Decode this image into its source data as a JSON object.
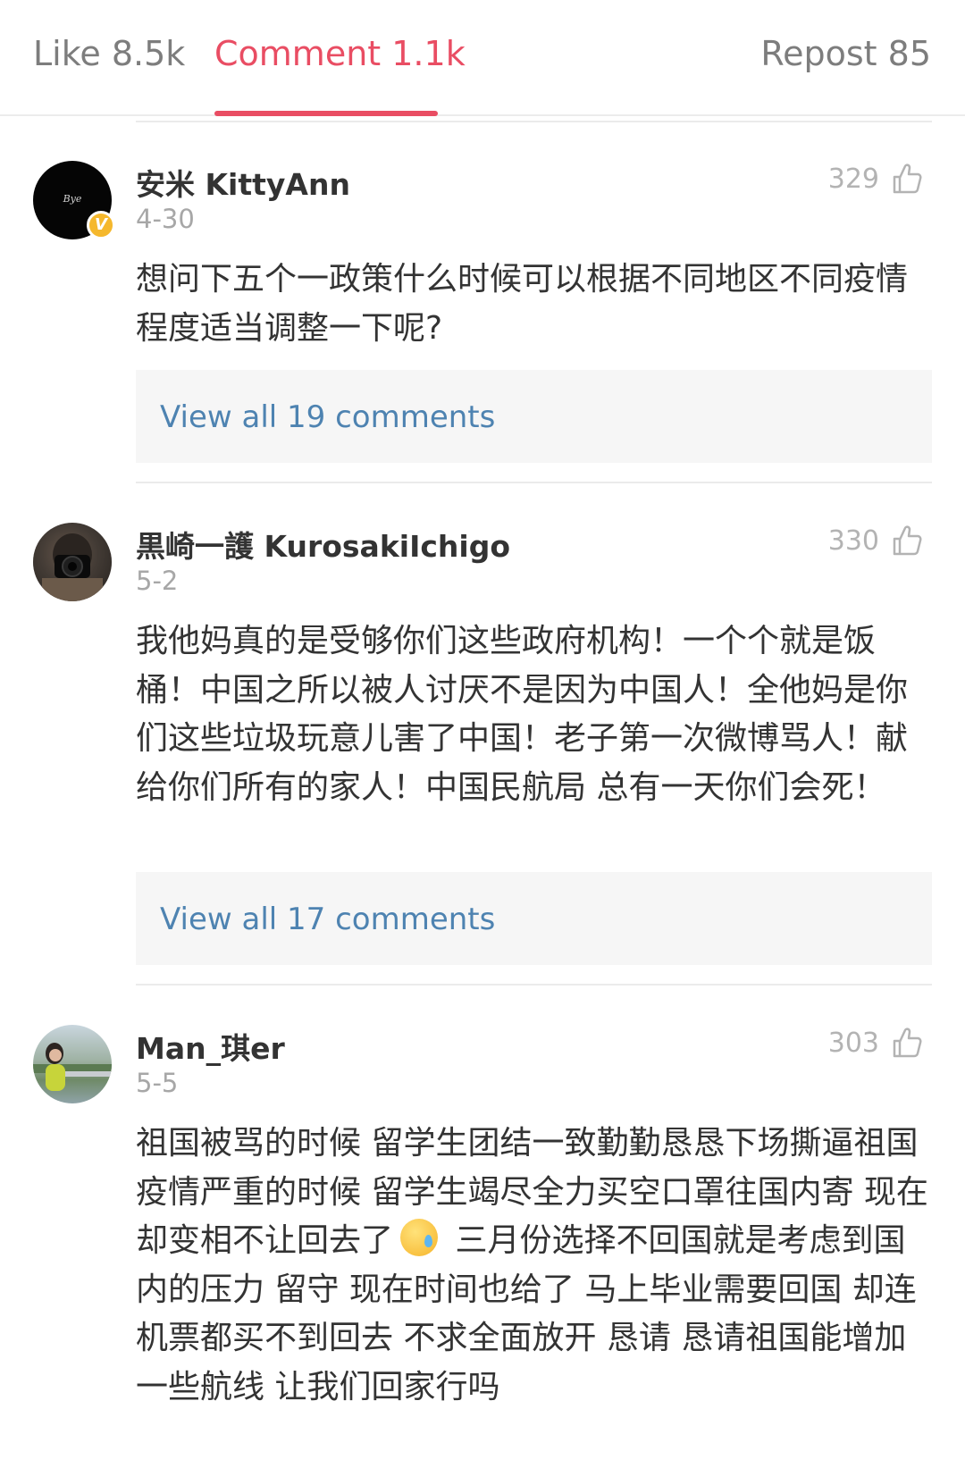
{
  "tabs": {
    "like": "Like 8.5k",
    "comment": "Comment 1.1k",
    "repost": "Repost 85",
    "active": "comment",
    "active_color": "#e94d63"
  },
  "comments": [
    {
      "username": "安米 KittyAnn",
      "date": "4-30",
      "likes": "329",
      "verified": true,
      "text": "想问下五个一政策什么时候可以根据不同地区不同疫情程度适当调整一下呢?",
      "view_all": "View all 19 comments"
    },
    {
      "username": "黒崎一護 KurosakiIchigo",
      "date": "5-2",
      "likes": "330",
      "verified": false,
      "text": "我他妈真的是受够你们这些政府机构！一个个就是饭桶！中国之所以被人讨厌不是因为中国人！全他妈是你们这些垃圾玩意儿害了中国！老子第一次微博骂人！献给你们所有的家人！中国民航局 总有一天你们会死！",
      "view_all": "View all 17 comments"
    },
    {
      "username": "Man_琪er",
      "date": "5-5",
      "likes": "303",
      "verified": false,
      "text_before_emoji": "祖国被骂的时候 留学生团结一致勤勤恳恳下场撕逼祖国疫情严重的时候 留学生竭尽全力买空口罩往国内寄 现在却变相不让回去了",
      "emoji": "sweat-emoji",
      "text_after_emoji": " 三月份选择不回国就是考虑到国内的压力 留守 现在时间也给了 马上毕业需要回国 却连机票都买不到回去 不求全面放开 恳请 恳请祖国能增加一些航线 让我们回家行吗"
    }
  ],
  "link_color": "#4e83b1"
}
